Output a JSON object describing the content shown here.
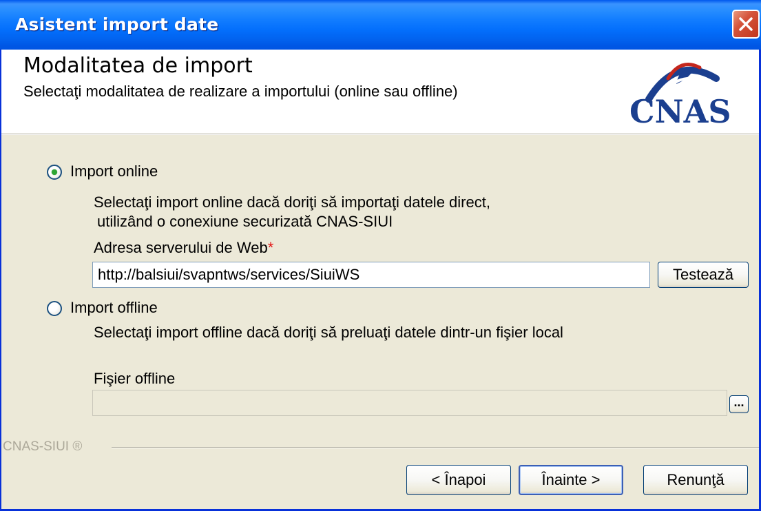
{
  "window": {
    "title": "Asistent import date"
  },
  "header": {
    "title": "Modalitatea de import",
    "subtitle": "Selectaţi modalitatea de realizare a importului (online sau offline)",
    "logo_text": "CNAS"
  },
  "online": {
    "label": "Import online",
    "selected": true,
    "description_line1": "Selectaţi import online dacă doriţi să importaţi datele direct,",
    "description_line2": "utilizând o conexiune securizată CNAS-SIUI",
    "server_label": "Adresa serverului de Web",
    "required_mark": "*",
    "server_value": "http://balsiui/svapntws/services/SiuiWS",
    "test_button": "Testează"
  },
  "offline": {
    "label": "Import offline",
    "selected": false,
    "description": "Selectaţi import offline dacă doriţi să preluaţi datele dintr-un fişier local",
    "file_label": "Fişier offline",
    "file_value": "",
    "browse_button": "..."
  },
  "footer": {
    "brand": "CNAS-SIUI ®",
    "back_button": "< Înapoi",
    "next_button": "Înainte >",
    "cancel_button": "Renunţă"
  },
  "colors": {
    "titlebar": "#0054e3",
    "radio_dot": "#2ea633",
    "required": "#e31414",
    "logo_blue": "#1b3f8f",
    "logo_red": "#c4261c"
  }
}
